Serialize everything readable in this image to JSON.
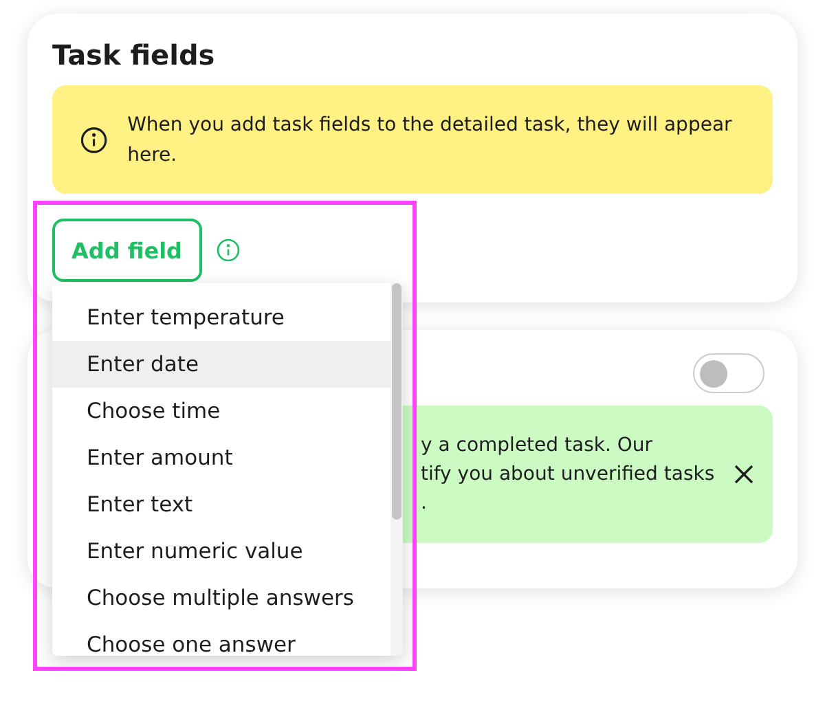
{
  "task_fields_card": {
    "title": "Task fields",
    "notice": {
      "text": "When you add task fields to the detailed task, they will appear here."
    },
    "add_field_button": {
      "label": "Add field"
    },
    "highlighted": true
  },
  "field_menu": {
    "items": [
      {
        "label": "Enter temperature",
        "selected": false
      },
      {
        "label": "Enter date",
        "selected": true
      },
      {
        "label": "Choose time",
        "selected": false
      },
      {
        "label": "Enter amount",
        "selected": false
      },
      {
        "label": "Enter text",
        "selected": false
      },
      {
        "label": "Enter numeric value",
        "selected": false
      },
      {
        "label": "Choose multiple answers",
        "selected": false
      },
      {
        "label": "Choose one answer",
        "selected": false
      }
    ]
  },
  "verification_card": {
    "toggle": {
      "on": false
    },
    "notice": {
      "lines": [
        "y a completed task. Our",
        "tify you about unverified tasks",
        "."
      ]
    }
  }
}
